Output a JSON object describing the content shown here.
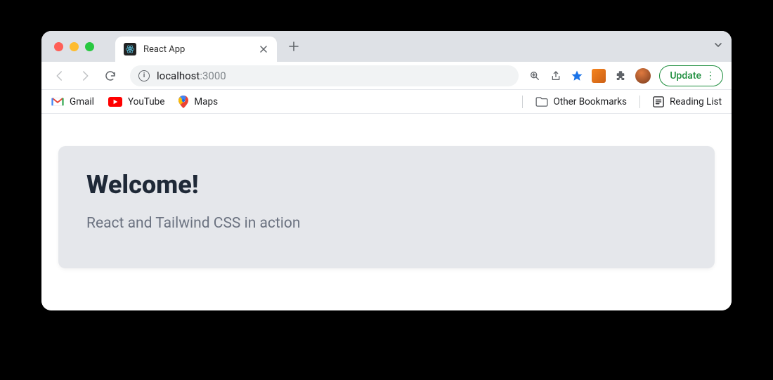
{
  "window": {
    "tab_title": "React App"
  },
  "toolbar": {
    "url_host": "localhost",
    "url_port": ":3000",
    "update_label": "Update"
  },
  "bookmarks": {
    "gmail": "Gmail",
    "youtube": "YouTube",
    "maps": "Maps",
    "other": "Other Bookmarks",
    "reading_list": "Reading List"
  },
  "page": {
    "heading": "Welcome!",
    "subheading": "React and Tailwind CSS in action"
  }
}
